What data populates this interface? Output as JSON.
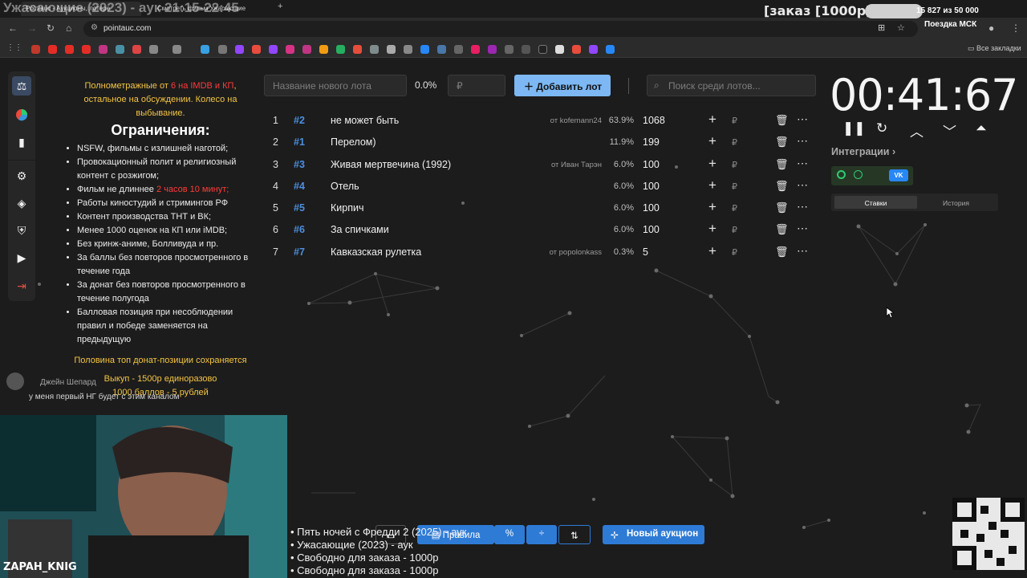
{
  "browser": {
    "tabs": [
      {
        "title": "Pointauc - Аукционы, лотере"
      },
      {
        "title": "Смотреть фильм Ужасающие"
      }
    ],
    "url": "pointauc.com",
    "all_bookmarks": "Все закладки"
  },
  "overlay": {
    "title": "Ужасающие (2023) - аук 21:15-22:45",
    "order": "[заказ [1000р]",
    "progress": "15 827  из 50 000",
    "trip": "Поездка МСК",
    "streamer": "ZAPAH_KNIG"
  },
  "rules": {
    "intro_before": "Полнометражные от ",
    "intro_highlight": "6 на IMDB и КП",
    "intro_after": ", остальное на обсуждении. Колесо на выбывание.",
    "heading": "Ограничения:",
    "items": [
      "NSFW, фильмы с излишней наготой;",
      "Провокационный полит и религиозный контент с розжигом;",
      "Фильм не длиннее ",
      "Работы киностудий и стримингов РФ",
      "Контент производства ТНТ и ВК;",
      "Менее 1000 оценок на КП или iMDB;",
      "Без кринж-аниме, Болливуда и пр.",
      "За баллы без повторов просмотренного в течение года",
      "За донат без повторов просмотренного в течение полугода",
      "Балловая позиция при несоблюдении правил и победе заменяется на предыдущую"
    ],
    "length_limit": "2 часов 10 минут;",
    "donate_keep": "Половина топ донат-позиции сохраняется",
    "buyout": "Выкуп - 1500р единоразово",
    "points_rate": "1000 баллов - 5 рублей"
  },
  "controls": {
    "lot_name_placeholder": "Название нового лота",
    "lot_pct": "0.0%",
    "currency": "₽",
    "add_lot": "Добавить лот",
    "search_placeholder": "Поиск среди лотов..."
  },
  "lots": [
    {
      "num": "1",
      "id": "#2",
      "name": "не может быть",
      "from": "от kofemann24",
      "pct": "63.9%",
      "amount": "1068"
    },
    {
      "num": "2",
      "id": "#1",
      "name": "Перелом)",
      "from": "",
      "pct": "11.9%",
      "amount": "199"
    },
    {
      "num": "3",
      "id": "#3",
      "name": "Живая мертвечина (1992)",
      "from": "от Иван Тарэн",
      "pct": "6.0%",
      "amount": "100"
    },
    {
      "num": "4",
      "id": "#4",
      "name": "Отель",
      "from": "",
      "pct": "6.0%",
      "amount": "100"
    },
    {
      "num": "5",
      "id": "#5",
      "name": "Кирпич",
      "from": "",
      "pct": "6.0%",
      "amount": "100"
    },
    {
      "num": "6",
      "id": "#6",
      "name": "За спичками",
      "from": "",
      "pct": "6.0%",
      "amount": "100"
    },
    {
      "num": "7",
      "id": "#7",
      "name": "Кавказская рулетка",
      "from": "от popolonkass",
      "pct": "0.3%",
      "amount": "5"
    }
  ],
  "timer": {
    "value": "00:41:67",
    "integrations": "Интеграции",
    "tab_bets": "Ставки",
    "tab_history": "История"
  },
  "bottom": {
    "rules_btn": "Правила",
    "new_auction": "Новый аукцион",
    "ticker": [
      "• Пять ночей с Фредди 2 (2025) - аук",
      "• Ужасающие (2023) - аук",
      "• Свободно для заказа - 1000р",
      "• Свободно для заказа - 1000р"
    ]
  },
  "chat": {
    "user": "Джейн Шепард",
    "message": "у меня первый НГ будет с этим каналом"
  }
}
